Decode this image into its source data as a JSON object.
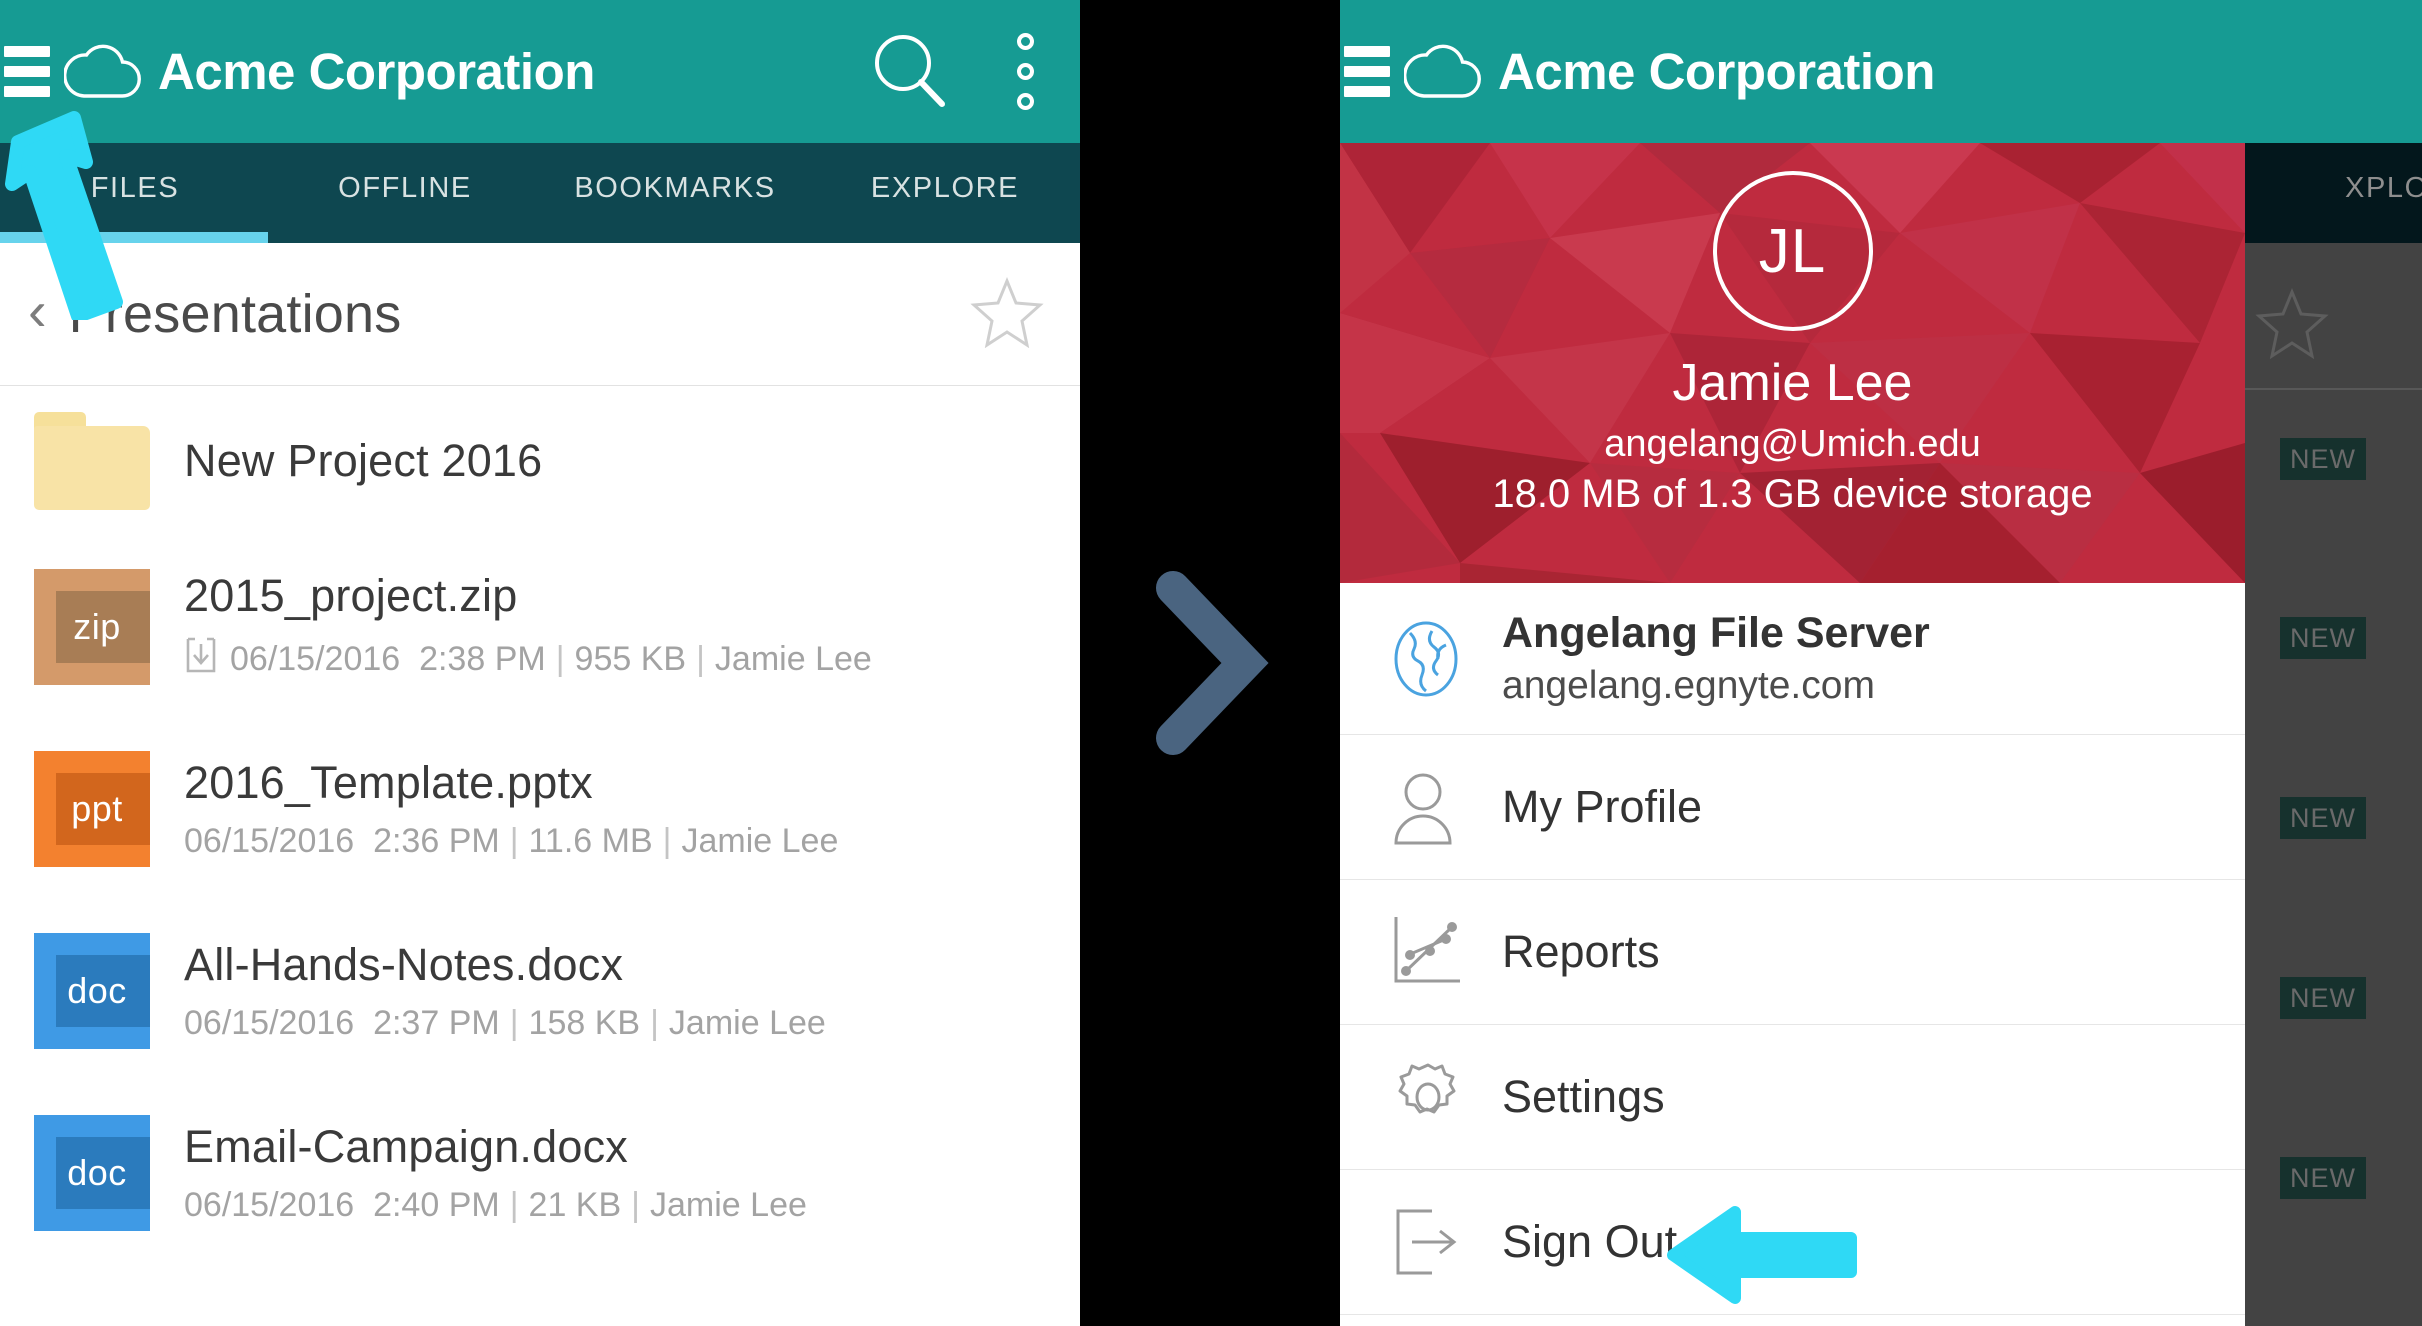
{
  "app": {
    "brand": "Acme Corporation",
    "accent_teal": "#169b93",
    "tabbar_bg": "#0e4750",
    "tab_indicator": "#67d3ec",
    "annotation_color": "#2fd9f5",
    "chevron_color": "#4a6480",
    "drawer_header_red": "#bf2b3f"
  },
  "header": {
    "menu_icon": "hamburger-icon",
    "logo_icon": "cloud-icon",
    "title": "Acme Corporation",
    "search_icon": "search-icon",
    "overflow_icon": "more-vertical-icon"
  },
  "tabs": [
    {
      "label": "FILES",
      "active": true
    },
    {
      "label": "OFFLINE",
      "active": false
    },
    {
      "label": "BOOKMARKS",
      "active": false
    },
    {
      "label": "EXPLORE",
      "active": false
    }
  ],
  "breadcrumb": {
    "back_icon": "chevron-left-icon",
    "title": "Presentations",
    "star_icon": "star-outline-icon"
  },
  "files": [
    {
      "type": "folder",
      "icon": "folder-icon",
      "name": "New Project 2016",
      "meta": "",
      "offline": false
    },
    {
      "type": "zip",
      "icon": "zip-file-icon",
      "badge": "zip",
      "name": "2015_project.zip",
      "date": "06/15/2016",
      "time": "2:38 PM",
      "size": "955 KB",
      "owner": "Jamie Lee",
      "offline": true,
      "offline_icon": "download-icon",
      "color": "#d49a6a",
      "color_inner": "#a87d55"
    },
    {
      "type": "ppt",
      "icon": "ppt-file-icon",
      "badge": "ppt",
      "name": "2016_Template.pptx",
      "date": "06/15/2016",
      "time": "2:36 PM",
      "size": "11.6 MB",
      "owner": "Jamie Lee",
      "offline": false,
      "color": "#f3812f",
      "color_inner": "#d2661d"
    },
    {
      "type": "doc",
      "icon": "doc-file-icon",
      "badge": "doc",
      "name": "All-Hands-Notes.docx",
      "date": "06/15/2016",
      "time": "2:37 PM",
      "size": "158 KB",
      "owner": "Jamie Lee",
      "offline": false,
      "color": "#3f9ae5",
      "color_inner": "#2b7bbd"
    },
    {
      "type": "doc",
      "icon": "doc-file-icon",
      "badge": "doc",
      "name": "Email-Campaign.docx",
      "date": "06/15/2016",
      "time": "2:40 PM",
      "size": "21 KB",
      "owner": "Jamie Lee",
      "offline": false,
      "color": "#3f9ae5",
      "color_inner": "#2b7bbd"
    }
  ],
  "divider": {
    "chevron_icon": "chevron-right-icon"
  },
  "dim_background": {
    "explore_tab_partial": "XPLORE",
    "star_icon": "star-outline-icon",
    "new_badges": [
      "NEW",
      "NEW",
      "NEW",
      "NEW",
      "NEW"
    ]
  },
  "drawer": {
    "profile": {
      "avatar_initials": "JL",
      "name": "Jamie Lee",
      "email": "angelang@Umich.edu",
      "storage": "18.0 MB of 1.3 GB device storage"
    },
    "items": [
      {
        "icon": "globe-icon",
        "title": "Angelang File Server",
        "subtitle": "angelang.egnyte.com"
      },
      {
        "icon": "person-icon",
        "title": "My Profile",
        "subtitle": ""
      },
      {
        "icon": "chart-icon",
        "title": "Reports",
        "subtitle": ""
      },
      {
        "icon": "gear-icon",
        "title": "Settings",
        "subtitle": ""
      },
      {
        "icon": "sign-out-icon",
        "title": "Sign Out",
        "subtitle": ""
      }
    ]
  },
  "annotations": [
    {
      "name": "menu-pointer-arrow",
      "direction": "up-left",
      "target": "hamburger-icon"
    },
    {
      "name": "sign-out-pointer-arrow",
      "direction": "left",
      "target": "sign-out-item"
    }
  ]
}
